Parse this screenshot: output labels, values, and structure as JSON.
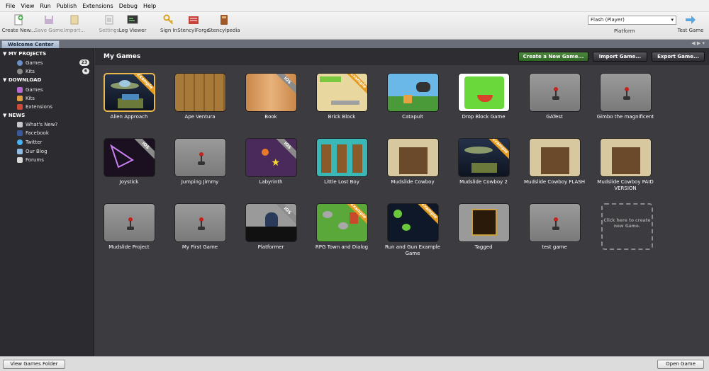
{
  "menu": [
    "File",
    "View",
    "Run",
    "Publish",
    "Extensions",
    "Debug",
    "Help"
  ],
  "toolbar": {
    "create_new": "Create New...",
    "save_game": "Save Game",
    "import": "Import...",
    "settings": "Settings",
    "log_viewer": "Log Viewer",
    "sign_in": "Sign In",
    "stencylforge": "StencylForge",
    "stencylpedia": "Stencylpedia",
    "platform_value": "Flash (Player)",
    "platform_label": "Platform",
    "test_game": "Test Game"
  },
  "tab": {
    "label": "Welcome Center"
  },
  "sidebar": {
    "my_projects": "MY PROJECTS",
    "games": "Games",
    "games_count": "23",
    "kits": "Kits",
    "kits_count": "6",
    "download": "DOWNLOAD",
    "dl_games": "Games",
    "dl_kits": "Kits",
    "dl_extensions": "Extensions",
    "news": "NEWS",
    "whats_new": "What's New?",
    "facebook": "Facebook",
    "twitter": "Twitter",
    "our_blog": "Our Blog",
    "forums": "Forums"
  },
  "main": {
    "title": "My Games",
    "create_btn": "Create a New Game...",
    "import_btn": "Import Game...",
    "export_btn": "Export Game...",
    "new_card": "Click here to create new Game."
  },
  "games": [
    {
      "name": "Alien Approach",
      "tag": "Example"
    },
    {
      "name": "Ape Ventura",
      "tag": ""
    },
    {
      "name": "Book",
      "tag": "iOS"
    },
    {
      "name": "Brick Block",
      "tag": "Example"
    },
    {
      "name": "Catapult",
      "tag": ""
    },
    {
      "name": "Drop Block Game",
      "tag": ""
    },
    {
      "name": "GATest",
      "tag": ""
    },
    {
      "name": "Gimbo the magnificent",
      "tag": ""
    },
    {
      "name": "Joystick",
      "tag": "iOS"
    },
    {
      "name": "Jumping Jimmy",
      "tag": ""
    },
    {
      "name": "Labyrinth",
      "tag": "iOS"
    },
    {
      "name": "Little Lost Boy",
      "tag": ""
    },
    {
      "name": "Mudslide Cowboy",
      "tag": ""
    },
    {
      "name": "Mudslide Cowboy 2",
      "tag": "Example"
    },
    {
      "name": "Mudslide Cowboy FLASH",
      "tag": ""
    },
    {
      "name": "Mudslide Cowboy PAID VERSION",
      "tag": ""
    },
    {
      "name": "Mudslide Project",
      "tag": ""
    },
    {
      "name": "My First Game",
      "tag": ""
    },
    {
      "name": "Platformer",
      "tag": "iOS"
    },
    {
      "name": "RPG Town and Dialog",
      "tag": "Example"
    },
    {
      "name": "Run and Gun Example Game",
      "tag": "Example"
    },
    {
      "name": "Tagged",
      "tag": ""
    },
    {
      "name": "test game",
      "tag": ""
    }
  ],
  "bottom": {
    "view_folder": "View Games Folder",
    "open_game": "Open Game"
  },
  "colors": {
    "selection": "#e8b84a",
    "create_button": "#3f7a33",
    "example_ribbon": "#e69a1e",
    "ios_ribbon": "#8a8a8a"
  }
}
